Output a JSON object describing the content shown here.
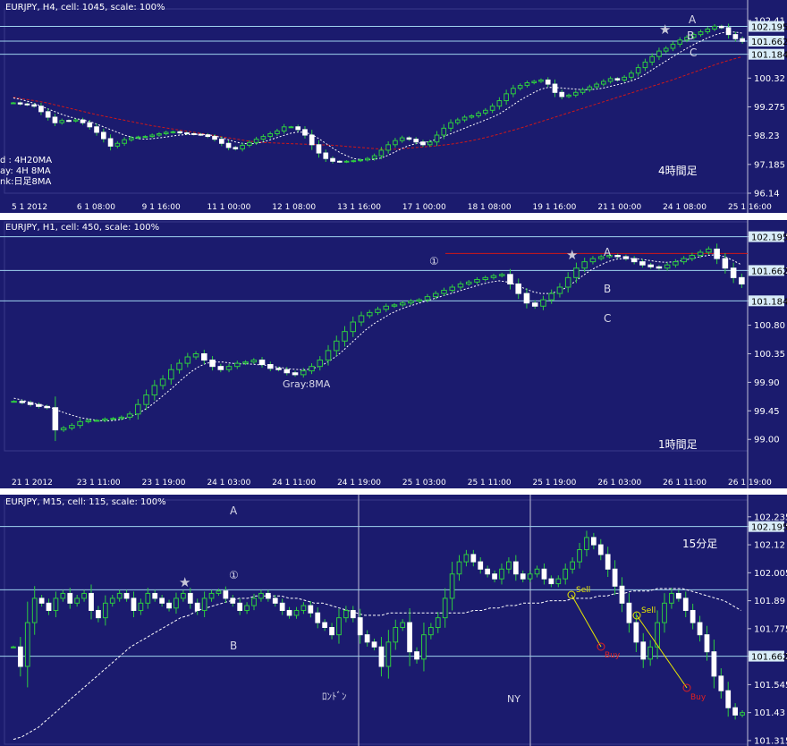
{
  "colors": {
    "background": "#1b1b6e",
    "bull_fill": "#1b1b6e",
    "bull_outline": "#2ecc40",
    "bear_fill": "#ffffff",
    "wick": "#2ecc40",
    "level_line": "#9fd3ee",
    "ma_fast": "#ffffff",
    "ma_daily": "#d01818",
    "star": "#c8c8d8",
    "fib_line": "#e8e800",
    "label": "#d8d8e8",
    "price_tag_bg": "#d8ecf8",
    "price_tag_text": "#000000"
  },
  "chart_data": [
    {
      "type": "candlestick",
      "title": "EURJPY, H4, cell: 1045, scale: 100%",
      "timeframe_label": "4時間足",
      "ylim": [
        96.14,
        102.44
      ],
      "y_ticks": [
        102.41,
        101.184,
        100.32,
        99.275,
        98.23,
        97.185,
        96.14
      ],
      "x_ticks": [
        "5 1 2012",
        "6 1 08:00",
        "9 1 16:00",
        "11 1 00:00",
        "12 1 08:00",
        "13 1 16:00",
        "17 1 00:00",
        "18 1 08:00",
        "19 1 16:00",
        "21 1 00:00",
        "24 1 08:00",
        "25 1 16:00"
      ],
      "levels": [
        102.195,
        101.662,
        101.184
      ],
      "level_tags": [
        "102.195",
        "101.662",
        "101.184"
      ],
      "annotations": {
        "A": "A",
        "B": "B",
        "C": "C"
      },
      "legend_lines": [
        "d : 4H20MA",
        "ay: 4H  8MA",
        "nk:日足8MA"
      ],
      "closes": [
        99.42,
        99.38,
        99.35,
        99.3,
        99.1,
        98.9,
        98.7,
        98.78,
        98.76,
        98.8,
        98.7,
        98.55,
        98.35,
        98.12,
        97.85,
        97.95,
        98.08,
        98.15,
        98.18,
        98.2,
        98.25,
        98.3,
        98.35,
        98.37,
        98.33,
        98.3,
        98.28,
        98.26,
        98.2,
        98.1,
        97.95,
        97.8,
        97.75,
        97.88,
        97.98,
        98.1,
        98.2,
        98.3,
        98.4,
        98.55,
        98.55,
        98.45,
        98.25,
        97.9,
        97.6,
        97.4,
        97.3,
        97.28,
        97.3,
        97.32,
        97.35,
        97.4,
        97.5,
        97.7,
        97.9,
        98.05,
        98.15,
        98.1,
        98.0,
        97.9,
        98.0,
        98.25,
        98.5,
        98.7,
        98.8,
        98.9,
        98.95,
        99.05,
        99.15,
        99.3,
        99.5,
        99.75,
        99.95,
        100.05,
        100.15,
        100.2,
        100.25,
        100.1,
        99.8,
        99.65,
        99.7,
        99.8,
        99.9,
        100.0,
        100.1,
        100.2,
        100.3,
        100.25,
        100.35,
        100.5,
        100.7,
        100.9,
        101.1,
        101.3,
        101.4,
        101.55,
        101.7,
        101.8,
        101.9,
        102.0,
        102.1,
        102.2,
        102.15,
        101.9,
        101.75,
        101.65
      ],
      "ma8": [
        99.6,
        99.55,
        99.48,
        99.4,
        99.3,
        99.2,
        99.1,
        99.0,
        98.92,
        98.85,
        98.8,
        98.74,
        98.65,
        98.55,
        98.45,
        98.35,
        98.25,
        98.18,
        98.12,
        98.1,
        98.12,
        98.15,
        98.18,
        98.22,
        98.25,
        98.27,
        98.28,
        98.28,
        98.26,
        98.22,
        98.16,
        98.08,
        98.0,
        97.95,
        97.93,
        97.95,
        98.0,
        98.08,
        98.16,
        98.24,
        98.32,
        98.36,
        98.35,
        98.27,
        98.12,
        97.95,
        97.78,
        97.62,
        97.5,
        97.4,
        97.36,
        97.35,
        97.37,
        97.42,
        97.52,
        97.64,
        97.77,
        97.87,
        97.94,
        97.98,
        98.02,
        98.1,
        98.2,
        98.3,
        98.4,
        98.5,
        98.6,
        98.7,
        98.8,
        98.9,
        99.02,
        99.18,
        99.35,
        99.52,
        99.66,
        99.8,
        99.92,
        99.98,
        99.98,
        99.96,
        99.94,
        99.92,
        99.9,
        99.9,
        99.92,
        99.96,
        100.02,
        100.08,
        100.14,
        100.22,
        100.32,
        100.46,
        100.62,
        100.78,
        100.94,
        101.1,
        101.25,
        101.4,
        101.54,
        101.66,
        101.78,
        101.88,
        101.96,
        102.0,
        101.99,
        101.95
      ],
      "ma20": [
        99.62,
        99.58,
        99.54,
        99.5,
        99.46,
        99.41,
        99.35,
        99.29,
        99.23,
        99.17,
        99.11,
        99.05,
        98.99,
        98.94,
        98.89,
        98.84,
        98.79,
        98.74,
        98.69,
        98.64,
        98.59,
        98.55,
        98.51,
        98.47,
        98.43,
        98.39,
        98.35,
        98.31,
        98.27,
        98.23,
        98.19,
        98.15,
        98.11,
        98.07,
        98.03,
        98.0,
        97.98,
        97.97,
        97.96,
        97.95,
        97.94,
        97.93,
        97.92,
        97.91,
        97.9,
        97.89,
        97.88,
        97.86,
        97.84,
        97.82,
        97.8,
        97.78,
        97.76,
        97.74,
        97.73,
        97.74,
        97.76,
        97.78,
        97.8,
        97.82,
        97.84,
        97.86,
        97.89,
        97.92,
        97.96,
        98.0,
        98.05,
        98.1,
        98.16,
        98.22,
        98.29,
        98.36,
        98.43,
        98.5,
        98.58,
        98.66,
        98.74,
        98.82,
        98.9,
        98.98,
        99.06,
        99.14,
        99.22,
        99.3,
        99.38,
        99.46,
        99.54,
        99.62,
        99.7,
        99.78,
        99.86,
        99.94,
        100.02,
        100.1,
        100.18,
        100.26,
        100.35,
        100.44,
        100.53,
        100.62,
        100.71,
        100.8,
        100.88,
        100.96,
        101.03,
        101.1
      ]
    },
    {
      "type": "candlestick",
      "title": "EURJPY, H1, cell: 450, scale: 100%",
      "timeframe_label": "1時間足",
      "ylim": [
        98.82,
        102.26
      ],
      "y_ticks": [
        102.195,
        101.662,
        101.184,
        100.8,
        100.35,
        99.9,
        99.45,
        99.0
      ],
      "x_ticks": [
        "21 1 2012",
        "23 1 11:00",
        "23 1 19:00",
        "24 1 03:00",
        "24 1 11:00",
        "24 1 19:00",
        "25 1 03:00",
        "25 1 11:00",
        "25 1 19:00",
        "26 1 03:00",
        "26 1 11:00",
        "26 1 19:00"
      ],
      "levels": [
        102.195,
        101.662,
        101.184
      ],
      "level_tags": [
        "102.195",
        "101.662",
        "101.184"
      ],
      "red_level": 101.93,
      "annotations": {
        "A": "A",
        "B": "B",
        "C": "C",
        "one": "①",
        "ma_label": "Gray:8MA"
      },
      "closes": [
        99.6,
        99.58,
        99.55,
        99.52,
        99.5,
        99.15,
        99.18,
        99.22,
        99.28,
        99.3,
        99.3,
        99.32,
        99.33,
        99.35,
        99.4,
        99.55,
        99.7,
        99.85,
        99.95,
        100.1,
        100.2,
        100.3,
        100.35,
        100.25,
        100.15,
        100.1,
        100.15,
        100.2,
        100.22,
        100.25,
        100.18,
        100.12,
        100.1,
        100.05,
        100.02,
        100.08,
        100.15,
        100.25,
        100.4,
        100.55,
        100.7,
        100.85,
        100.95,
        101.0,
        101.05,
        101.1,
        101.12,
        101.15,
        101.18,
        101.2,
        101.25,
        101.3,
        101.35,
        101.4,
        101.45,
        101.48,
        101.52,
        101.55,
        101.58,
        101.6,
        101.45,
        101.3,
        101.15,
        101.1,
        101.2,
        101.3,
        101.4,
        101.55,
        101.7,
        101.8,
        101.85,
        101.88,
        101.9,
        101.88,
        101.85,
        101.8,
        101.75,
        101.72,
        101.7,
        101.75,
        101.8,
        101.85,
        101.9,
        101.95,
        102.0,
        101.85,
        101.7,
        101.55,
        101.45
      ],
      "ma8": [
        99.65,
        99.62,
        99.58,
        99.55,
        99.52,
        99.47,
        99.42,
        99.38,
        99.34,
        99.32,
        99.3,
        99.29,
        99.3,
        99.32,
        99.36,
        99.42,
        99.5,
        99.6,
        99.71,
        99.82,
        99.94,
        100.05,
        100.14,
        100.2,
        100.22,
        100.22,
        100.2,
        100.19,
        100.19,
        100.18,
        100.17,
        100.15,
        100.13,
        100.11,
        100.1,
        100.1,
        100.13,
        100.18,
        100.26,
        100.36,
        100.48,
        100.6,
        100.72,
        100.82,
        100.9,
        100.98,
        101.04,
        101.09,
        101.13,
        101.17,
        101.21,
        101.25,
        101.29,
        101.33,
        101.37,
        101.41,
        101.45,
        101.48,
        101.5,
        101.48,
        101.44,
        101.38,
        101.33,
        101.3,
        101.3,
        101.33,
        101.39,
        101.48,
        101.58,
        101.67,
        101.74,
        101.8,
        101.84,
        101.85,
        101.85,
        101.84,
        101.82,
        101.8,
        101.79,
        101.8,
        101.82,
        101.85,
        101.88,
        101.9,
        101.91,
        101.88,
        101.82,
        101.75
      ]
    },
    {
      "type": "candlestick",
      "title": "EURJPY, M15, cell: 115, scale: 100%",
      "timeframe_label": "15分足",
      "ylim": [
        101.3,
        102.26
      ],
      "y_ticks": [
        102.235,
        102.195,
        102.12,
        102.005,
        101.89,
        101.775,
        101.662,
        101.545,
        101.43,
        101.315
      ],
      "x_ticks": [],
      "levels": [
        102.195,
        101.935,
        101.662
      ],
      "level_tags": [
        "102.195",
        "101.662"
      ],
      "session_labels": [
        "ﾛﾝﾄﾞﾝ",
        "NY"
      ],
      "annotations": {
        "A": "A",
        "B": "B",
        "one": "①",
        "sell1": "Sell",
        "buy1": "Buy",
        "sell2": "Sell",
        "buy2": "Buy"
      },
      "closes": [
        101.7,
        101.62,
        101.8,
        101.9,
        101.88,
        101.85,
        101.9,
        101.92,
        101.88,
        101.9,
        101.92,
        101.85,
        101.82,
        101.88,
        101.9,
        101.92,
        101.9,
        101.85,
        101.88,
        101.92,
        101.9,
        101.88,
        101.86,
        101.9,
        101.92,
        101.88,
        101.85,
        101.9,
        101.92,
        101.93,
        101.9,
        101.88,
        101.85,
        101.87,
        101.9,
        101.92,
        101.9,
        101.88,
        101.85,
        101.83,
        101.85,
        101.87,
        101.84,
        101.8,
        101.78,
        101.75,
        101.82,
        101.85,
        101.82,
        101.75,
        101.72,
        101.7,
        101.62,
        101.72,
        101.78,
        101.8,
        101.68,
        101.65,
        101.75,
        101.78,
        101.82,
        101.9,
        102.0,
        102.05,
        102.08,
        102.05,
        102.02,
        102.0,
        101.98,
        102.02,
        102.05,
        102.0,
        101.98,
        102.0,
        102.02,
        101.98,
        101.96,
        101.98,
        102.02,
        102.05,
        102.1,
        102.15,
        102.12,
        102.08,
        102.02,
        101.95,
        101.88,
        101.8,
        101.72,
        101.65,
        101.7,
        101.8,
        101.88,
        101.92,
        101.9,
        101.85,
        101.8,
        101.75,
        101.68,
        101.58,
        101.52,
        101.45,
        101.42,
        101.43
      ],
      "ma": [
        101.32,
        101.33,
        101.35,
        101.37,
        101.4,
        101.43,
        101.46,
        101.49,
        101.52,
        101.55,
        101.58,
        101.61,
        101.64,
        101.67,
        101.7,
        101.72,
        101.74,
        101.76,
        101.78,
        101.8,
        101.82,
        101.83,
        101.85,
        101.86,
        101.87,
        101.88,
        101.89,
        101.9,
        101.9,
        101.91,
        101.91,
        101.91,
        101.91,
        101.9,
        101.9,
        101.89,
        101.88,
        101.88,
        101.87,
        101.86,
        101.85,
        101.84,
        101.83,
        101.83,
        101.83,
        101.84,
        101.84,
        101.84,
        101.84,
        101.84,
        101.84,
        101.84,
        101.84,
        101.84,
        101.84,
        101.85,
        101.85,
        101.86,
        101.86,
        101.87,
        101.87,
        101.88,
        101.88,
        101.88,
        101.89,
        101.89,
        101.89,
        101.9,
        101.9,
        101.9,
        101.91,
        101.91,
        101.92,
        101.92,
        101.93,
        101.93,
        101.93,
        101.94,
        101.94,
        101.94,
        101.94,
        101.93,
        101.92,
        101.91,
        101.9,
        101.89,
        101.87,
        101.85
      ]
    }
  ]
}
